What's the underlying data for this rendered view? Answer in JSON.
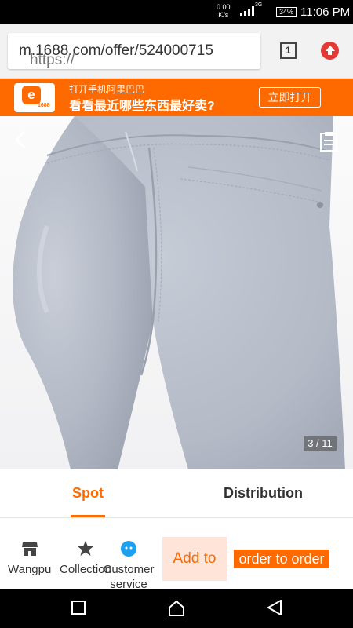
{
  "status_bar": {
    "speed_value": "0.00",
    "speed_unit": "K/s",
    "network": "3G",
    "battery": "34%",
    "time": "11:06 PM"
  },
  "browser": {
    "url_scheme": "https://",
    "url_rest": "m.1688.com/offer/524000715",
    "tab_count": "1"
  },
  "app_banner": {
    "logo_text": "1688",
    "line1": "打开手机阿里巴巴",
    "line2": "看看最近哪些东西最好卖?",
    "open_button": "立即打开"
  },
  "gallery": {
    "counter": "3 / 11"
  },
  "tabs": [
    {
      "label": "Spot",
      "active": true
    },
    {
      "label": "Distribution",
      "active": false
    }
  ],
  "bottom_bar": {
    "wangpu": "Wangpu",
    "collection": "Collection",
    "customer_service": "Customer service",
    "add_to": "Add to",
    "order": "order to order"
  },
  "colors": {
    "accent": "#ff6a00",
    "service_icon": "#1ea0f0"
  }
}
